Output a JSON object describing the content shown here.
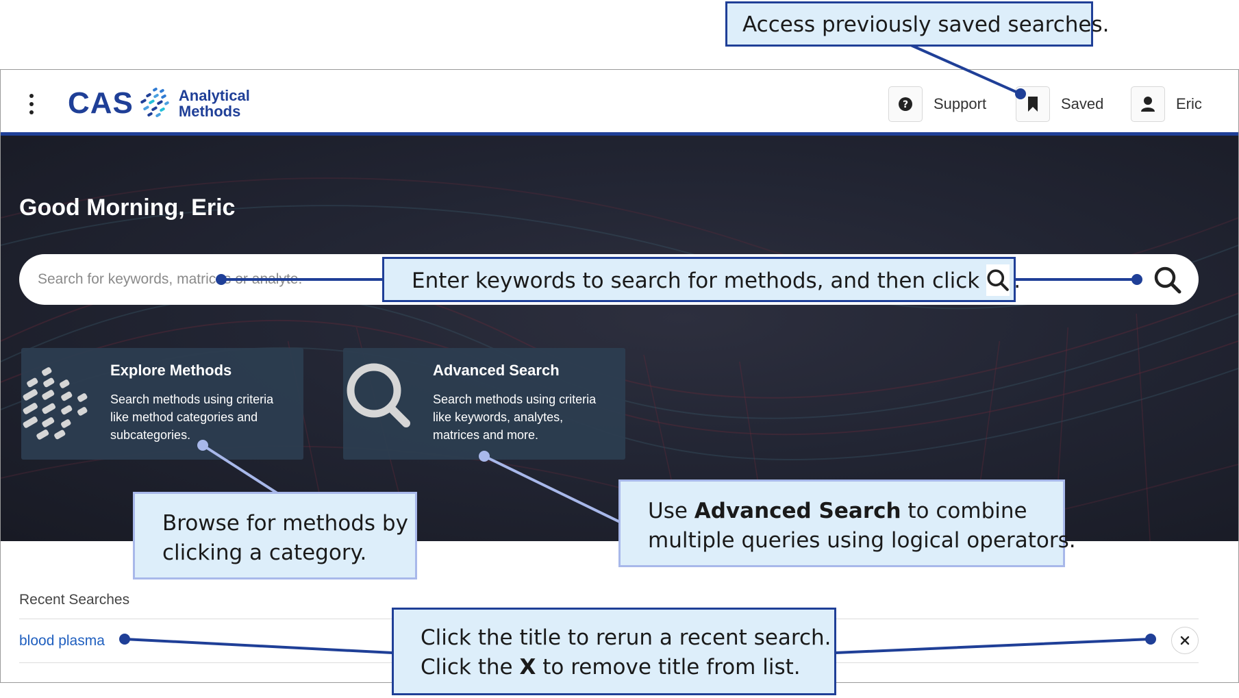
{
  "app": {
    "logo_wordmark": "CAS",
    "logo_text_line1": "Analytical",
    "logo_text_line2": "Methods",
    "nav": {
      "support_label": "Support",
      "saved_label": "Saved",
      "user_label": "Eric"
    }
  },
  "hero": {
    "greeting": "Good Morning, Eric",
    "search": {
      "placeholder": "Search for keywords, matrices or analyte.",
      "value": ""
    },
    "cards": [
      {
        "title": "Explore Methods",
        "description_lines": [
          "Search methods using criteria",
          "like method categories and",
          "subcategories."
        ],
        "icon": "explore-methods-icon"
      },
      {
        "title": "Advanced Search",
        "description_lines": [
          "Search methods using criteria",
          "like keywords, analytes,",
          "matrices and more."
        ],
        "icon": "magnifier-icon"
      }
    ]
  },
  "recent": {
    "heading": "Recent Searches",
    "items": [
      {
        "title": "blood plasma",
        "remove_label": "×"
      }
    ]
  },
  "callouts": {
    "saved": {
      "text": "Access previously saved searches."
    },
    "search": {
      "text_before": "Enter keywords to search for methods, and then click",
      "text_after": "."
    },
    "browse": {
      "line1": "Browse for methods by",
      "line2": "clicking a category."
    },
    "advanced": {
      "line1_prefix": "Use ",
      "line1_bold": "Advanced Search",
      "line1_suffix": " to combine",
      "line2": "multiple queries using logical operators."
    },
    "recent": {
      "line1": "Click the title to rerun a recent search.",
      "line2_prefix": "Click the ",
      "line2_bold": "X",
      "line2_suffix": " to remove title from list."
    }
  },
  "colors": {
    "brand_blue": "#1f3f97",
    "callout_fill": "#ddeefa",
    "callout_border_dark": "#1f3f97",
    "callout_border_light": "#a8b8ea",
    "card_fill": "#2c3d50",
    "link_blue": "#1f5fbf"
  }
}
